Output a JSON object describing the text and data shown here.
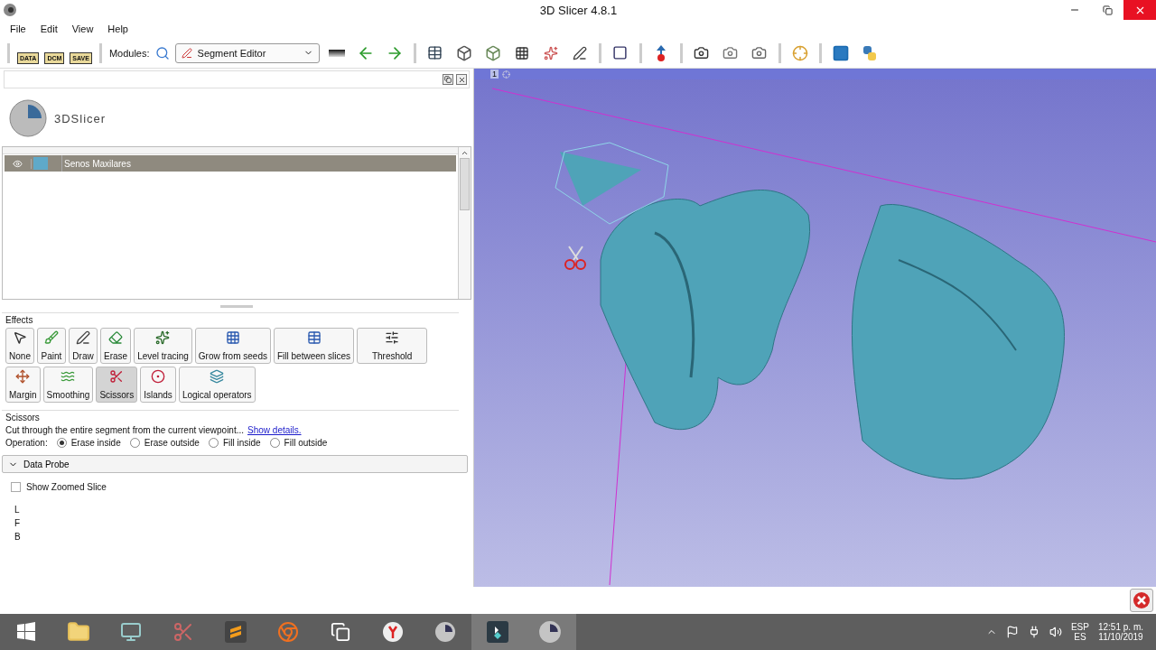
{
  "window": {
    "title": "3D Slicer 4.8.1"
  },
  "menu": [
    "File",
    "Edit",
    "View",
    "Help"
  ],
  "toolbar": {
    "file_buttons": [
      "DATA",
      "DCM",
      "SAVE"
    ],
    "modules_label": "Modules:",
    "module_select": "Segment Editor"
  },
  "logo": {
    "text": "3DSlicer"
  },
  "segments": [
    {
      "name": "Senos Maxilares",
      "color": "#5fa9c9",
      "visible": true,
      "selected": true
    }
  ],
  "effects": [
    {
      "label": "None",
      "selected": false
    },
    {
      "label": "Paint",
      "selected": false
    },
    {
      "label": "Draw",
      "selected": false
    },
    {
      "label": "Erase",
      "selected": false
    },
    {
      "label": "Level tracing",
      "selected": false
    },
    {
      "label": "Grow from seeds",
      "selected": false
    },
    {
      "label": "Fill between slices",
      "selected": false
    },
    {
      "label": "Threshold",
      "selected": false
    },
    {
      "label": "Margin",
      "selected": false
    },
    {
      "label": "Smoothing",
      "selected": false
    },
    {
      "label": "Scissors",
      "selected": true
    },
    {
      "label": "Islands",
      "selected": false
    },
    {
      "label": "Logical operators",
      "selected": false
    }
  ],
  "effects_title": "Effects",
  "scissors": {
    "title": "Scissors",
    "description": "Cut through the entire segment from the current viewpoint...",
    "link": "Show details.",
    "operation_label": "Operation:",
    "operations": [
      {
        "label": "Erase inside",
        "selected": true
      },
      {
        "label": "Erase outside",
        "selected": false
      },
      {
        "label": "Fill inside",
        "selected": false
      },
      {
        "label": "Fill outside",
        "selected": false
      }
    ]
  },
  "data_probe": {
    "title": "Data Probe",
    "expanded": true,
    "show_zoomed_slice": {
      "label": "Show Zoomed Slice",
      "checked": false
    },
    "coords": [
      "L",
      "F",
      "B"
    ]
  },
  "view": {
    "number": "1"
  },
  "taskbar": {
    "language": "ESP",
    "layout": "ES",
    "time": "12:51 p. m.",
    "date": "11/10/2019"
  }
}
